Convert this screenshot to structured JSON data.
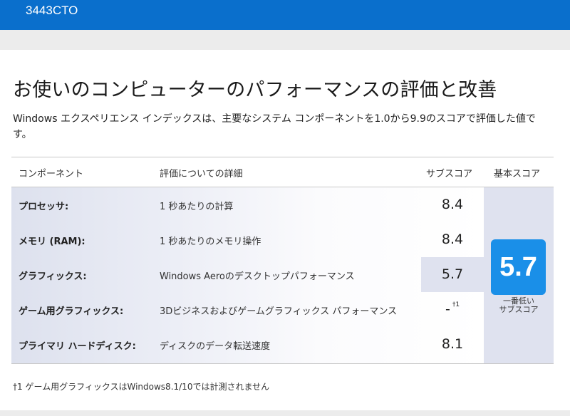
{
  "header": {
    "model": "3443CTO"
  },
  "page": {
    "title": "お使いのコンピューターのパフォーマンスの評価と改善",
    "intro": "Windows エクスペリエンス インデックスは、主要なシステム コンポーネントを1.0から9.9のスコアで評価した値です。"
  },
  "table": {
    "headers": {
      "component": "コンポーネント",
      "detail": "評価についての詳細",
      "subscore": "サブスコア",
      "basescore": "基本スコア"
    },
    "rows": [
      {
        "label": "プロセッサ:",
        "detail": "1 秒あたりの計算",
        "score": "8.4",
        "note": ""
      },
      {
        "label": "メモリ (RAM):",
        "detail": "1 秒あたりのメモリ操作",
        "score": "8.4",
        "note": ""
      },
      {
        "label": "グラフィックス:",
        "detail": "Windows Aeroのデスクトップパフォーマンス",
        "score": "5.7",
        "note": ""
      },
      {
        "label": "ゲーム用グラフィックス:",
        "detail": "3Dビジネスおよびゲームグラフィックス パフォーマンス",
        "score": "-",
        "note": "†1"
      },
      {
        "label": "プライマリ ハードディスク:",
        "detail": "ディスクのデータ転送速度",
        "score": "8.1",
        "note": ""
      }
    ],
    "base_score": "5.7",
    "base_caption_line1": "一番低い",
    "base_caption_line2": "サブスコア"
  },
  "footnote": "†1 ゲーム用グラフィックスはWindows8.1/10では計測されません",
  "colors": {
    "topbar": "#0a6fcc",
    "badge": "#1a8fe8",
    "highlight": "#dfe2ef"
  }
}
